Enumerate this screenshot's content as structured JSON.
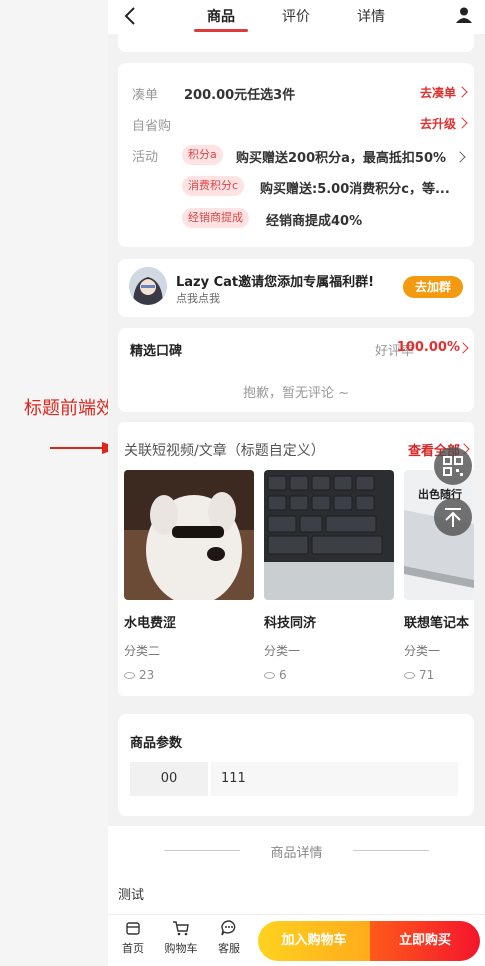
{
  "header": {
    "tabs": [
      {
        "label": "商品"
      },
      {
        "label": "评价"
      },
      {
        "label": "详情"
      }
    ]
  },
  "promo": {
    "rows": [
      {
        "label": "凑单",
        "text": "200.00元任选3件",
        "link": "去凑单"
      },
      {
        "label": "自省购",
        "link": "去升级"
      },
      {
        "label": "活动"
      }
    ],
    "activities": [
      {
        "tag": "积分a",
        "text": "购买赠送200积分a，最高抵扣50%"
      },
      {
        "tag": "消费积分c",
        "text": "购买赠送:5.00消费积分c，等..."
      },
      {
        "tag": "经销商提成",
        "text": "经销商提成40%"
      }
    ]
  },
  "invite": {
    "title": "Lazy Cat邀请您添加专属福利群!",
    "subtitle": "点我点我",
    "button": "去加群"
  },
  "review": {
    "title": "精选口碑",
    "rate_label": "好评率",
    "rate": "100.00%",
    "empty": "抱歉，暂无评论 ~"
  },
  "annotation": "标题前端效果展示",
  "related": {
    "title": "关联短视频/文章（标题自定义）",
    "view_all": "查看全部",
    "items": [
      {
        "name": "水电费涩",
        "category": "分类二",
        "views": "23"
      },
      {
        "name": "科技同济",
        "category": "分类一",
        "views": "6"
      },
      {
        "name": "联想笔记本",
        "category": "分类一",
        "views": "71",
        "image_text": "出色随行"
      }
    ]
  },
  "params": {
    "title": "商品参数",
    "rows": [
      {
        "key": "00",
        "value": "111"
      }
    ]
  },
  "details": {
    "title": "商品详情",
    "body": "测试"
  },
  "bottom": {
    "nav": [
      {
        "label": "首页"
      },
      {
        "label": "购物车"
      },
      {
        "label": "客服"
      }
    ],
    "add_cart": "加入购物车",
    "buy_now": "立即购买"
  },
  "colors": {
    "accent_red": "#e0312f",
    "orange": "#f39a10"
  }
}
